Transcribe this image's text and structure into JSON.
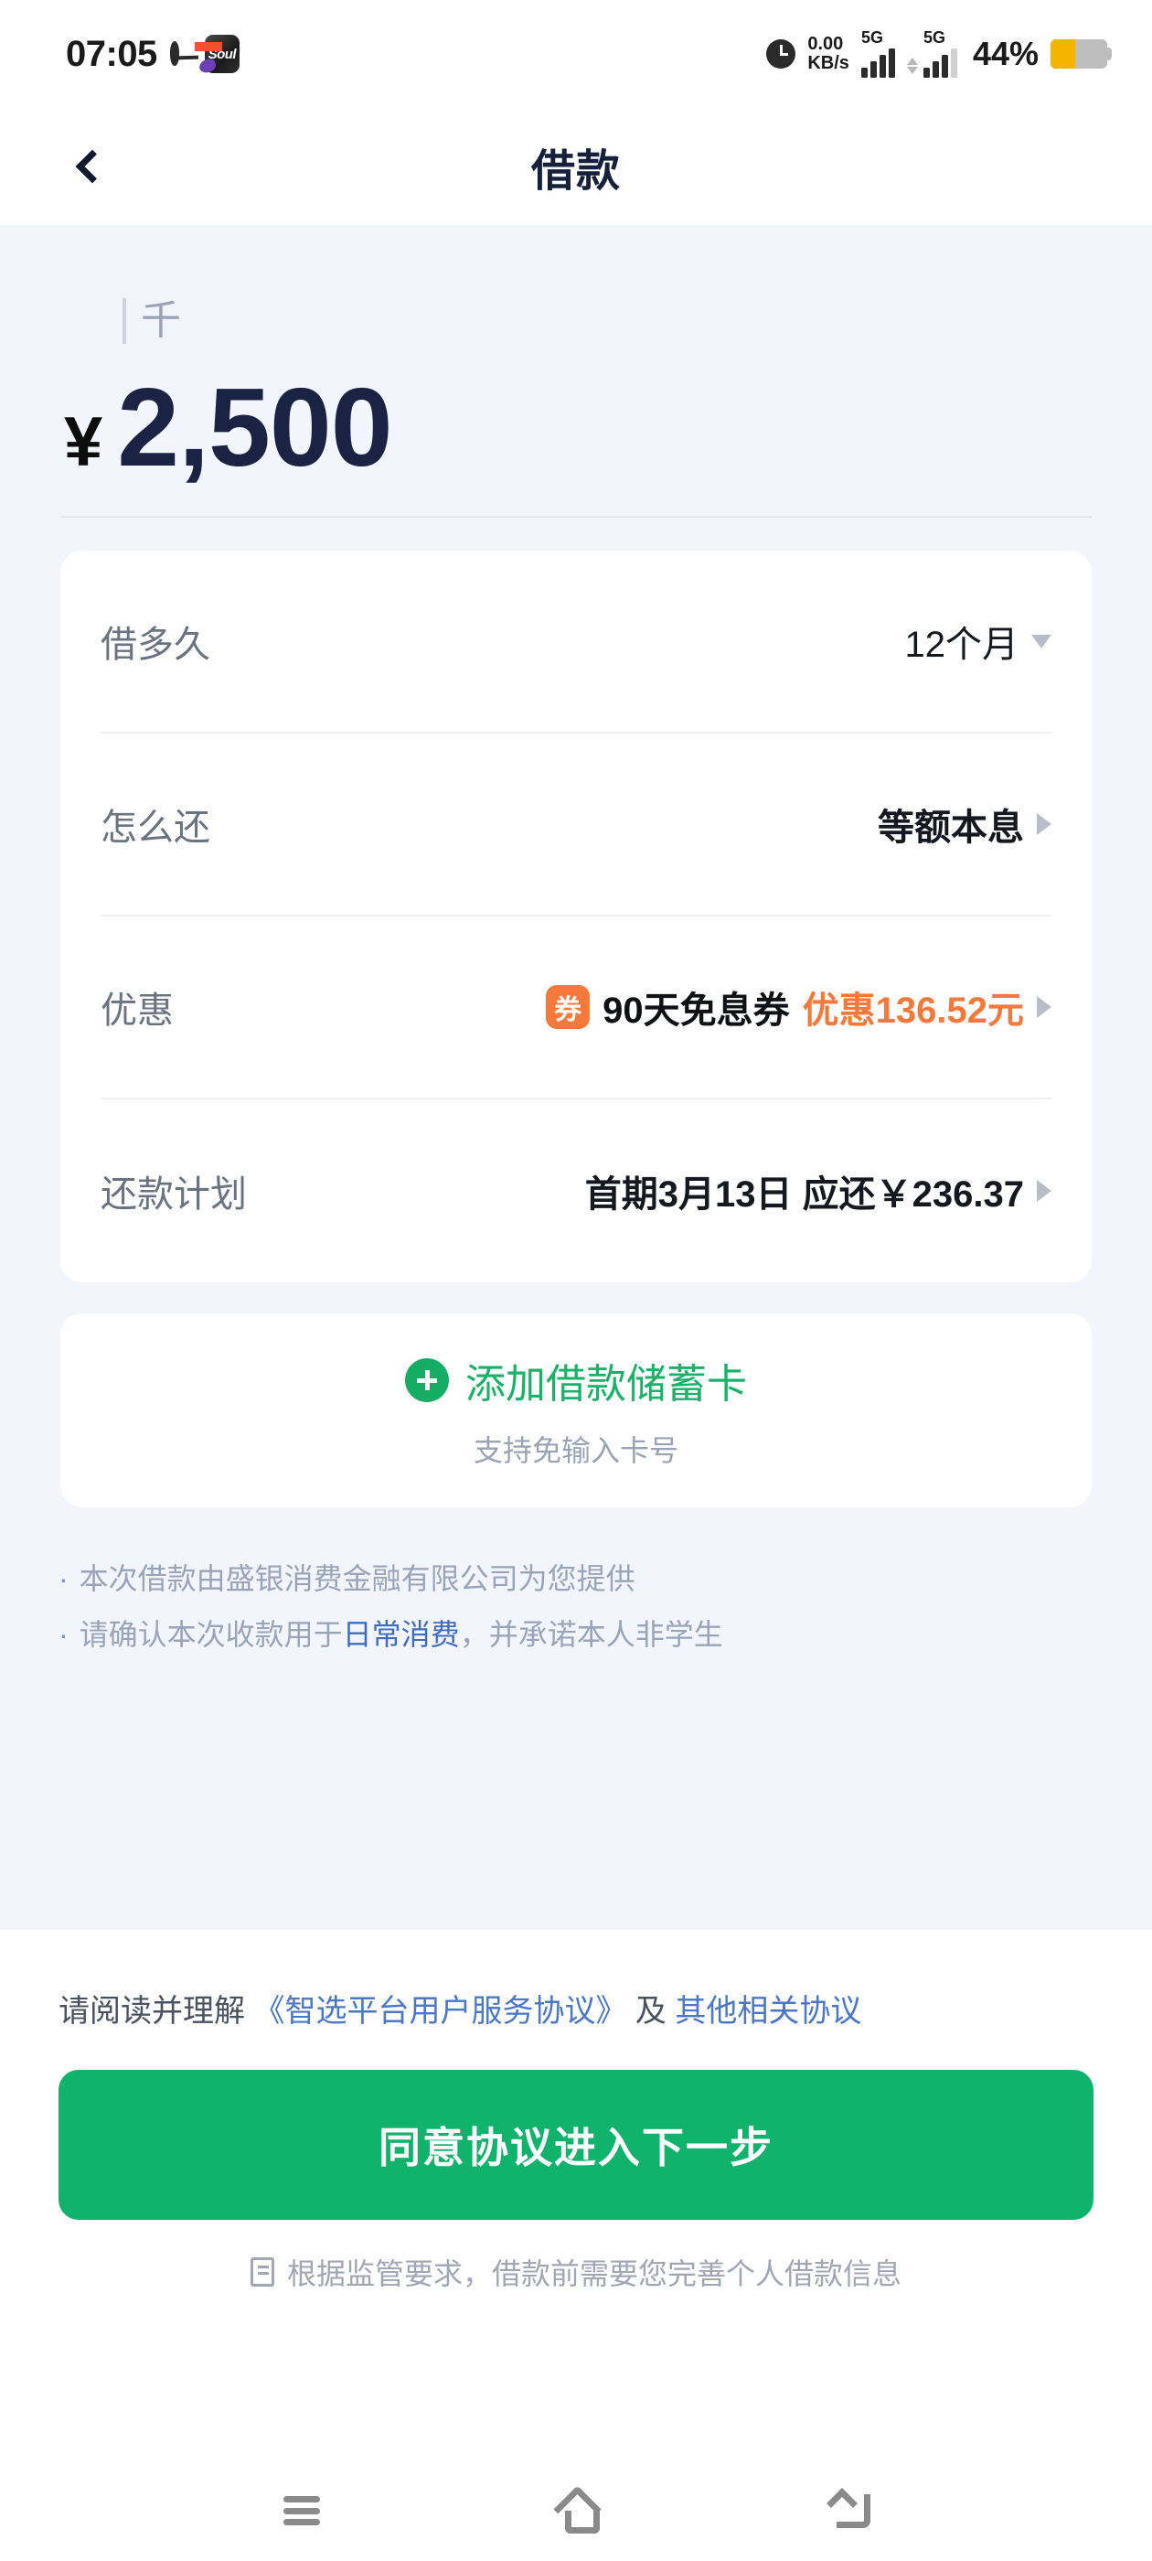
{
  "status_bar": {
    "time": "07:05",
    "network_speed": "0.00\nKB/s",
    "network_speed_value": "0.00",
    "network_speed_unit": "KB/s",
    "sim1_network": "5G",
    "sim2_network": "5G",
    "battery_percent": "44%",
    "battery_level": 44,
    "app_icon_soul_label": "Soul"
  },
  "header": {
    "title": "借款",
    "back_label": "返回"
  },
  "amount": {
    "unit_hint": "千",
    "currency_symbol": "¥",
    "value": "2,500"
  },
  "details": {
    "rows": [
      {
        "label": "借多久",
        "value": "12个月",
        "indicator": "chevron-down-icon"
      },
      {
        "label": "怎么还",
        "value": "等额本息",
        "indicator": "chevron-right-icon"
      },
      {
        "label": "优惠",
        "badge": "券",
        "coupon_name": "90天免息券",
        "coupon_discount": "优惠136.52元",
        "indicator": "chevron-right-icon"
      },
      {
        "label": "还款计划",
        "value": "首期3月13日 应还￥236.37",
        "indicator": "chevron-right-icon"
      }
    ]
  },
  "add_card": {
    "title": "添加借款储蓄卡",
    "subtitle": "支持免输入卡号"
  },
  "notes": [
    {
      "bullet": "·",
      "text": "本次借款由盛银消费金融有限公司为您提供"
    },
    {
      "bullet": "·",
      "prefix": "请确认本次收款用于",
      "highlight": "日常消费",
      "suffix": "，并承诺本人非学生"
    }
  ],
  "agreement": {
    "prefix": "请阅读并理解 ",
    "link1": "《智选平台用户服务协议》",
    "middle": " 及 ",
    "link2": "其他相关协议"
  },
  "cta": {
    "label": "同意协议进入下一步"
  },
  "footnote": {
    "text": "根据监管要求，借款前需要您完善个人借款信息",
    "icon": "document-icon"
  },
  "nav_bar": {
    "recents_label": "最近任务",
    "home_label": "主页",
    "back_label": "返回"
  },
  "colors": {
    "brand_green": "#10b36c",
    "accent_orange": "#f4793b",
    "link_blue": "#4a78c7",
    "title_navy": "#17203b",
    "page_bg": "#f2f5fb",
    "battery_yellow": "#f5b400"
  }
}
